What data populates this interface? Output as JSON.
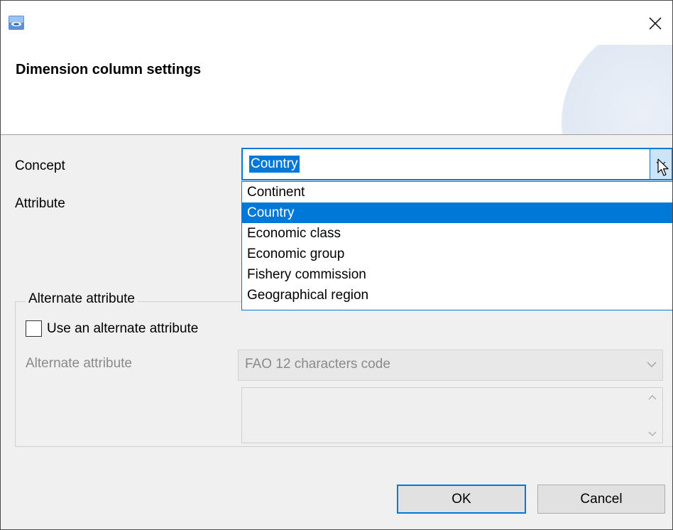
{
  "window": {
    "title": "Dimension column settings",
    "icons": {
      "app": "app-icon",
      "close": "close-icon"
    }
  },
  "form": {
    "concept_label": "Concept",
    "attribute_label": "Attribute",
    "concept_value": "Country",
    "concept_options": [
      "Continent",
      "Country",
      "Economic class",
      "Economic group",
      "Fishery commission",
      "Geographical region"
    ],
    "concept_selected_index": 1
  },
  "alternate": {
    "group_title": "Alternate attribute",
    "checkbox_label": "Use an alternate attribute",
    "checkbox_checked": false,
    "field_label": "Alternate attribute",
    "field_value": "FAO 12 characters code",
    "textarea_value": ""
  },
  "buttons": {
    "ok": "OK",
    "cancel": "Cancel"
  },
  "colors": {
    "accent": "#0078d7",
    "selection_bg": "#0078d7",
    "dialog_bg": "#f0f0f0"
  }
}
